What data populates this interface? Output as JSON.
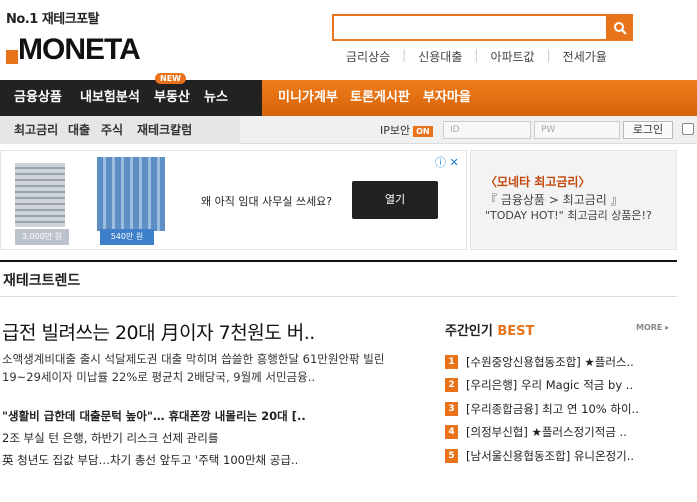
{
  "header": {
    "slogan": "No.1 재테크포탈",
    "logo": "MONETA",
    "search_placeholder": "",
    "hot_keywords": [
      "금리상승",
      "신용대출",
      "아파트값",
      "전세가율"
    ]
  },
  "nav": {
    "main": [
      "금융상품",
      "내보험분석",
      "부동산",
      "뉴스"
    ],
    "main_right": [
      "미니가계부",
      "토론게시판",
      "부자마을"
    ],
    "new_badge": "NEW",
    "sub": [
      "최고금리",
      "대출",
      "주식",
      "재테크칼럼"
    ]
  },
  "login": {
    "ip_security": "IP보안",
    "on": "ON",
    "id_placeholder": "ID",
    "pw_placeholder": "PW",
    "button": "로그인"
  },
  "ad": {
    "text": "왜 아직 임대 사무실 쓰세요?",
    "button": "열기",
    "label1": "3,000만 원",
    "label2": "540만 원",
    "icons": "ⓘ ✕"
  },
  "promo": {
    "line1": "〈모네타 최고금리〉",
    "line2": "『 금융상품 > 최고금리 』",
    "line3": "\"TODAY HOT!\" 최고금리 상품은!?"
  },
  "section": {
    "title": "재테크트렌드",
    "headline": "급전 빌려쓰는 20대 月이자 7천원도 버..",
    "summary": "소액생계비대출 출시 석달제도권 대출 막히며 씁쓸한 흥행한달 61만원안팎 빌린 19~29세이자 미납률 22%로 평균치 2배당국, 9월께 서민금융..",
    "news": [
      "\"생활비 급한데 대출문턱 높아\"… 휴대폰깡 내몰리는 20대 [..",
      "2조 부실 턴 은행, 하반기 리스크 선제 관리를",
      "英 청년도 집값 부담…차기 총선 앞두고 '주택 100만채 공급.."
    ]
  },
  "best": {
    "title_prefix": "주간인기 ",
    "title_accent": "BEST",
    "more": "MORE ▸",
    "items": [
      {
        "num": "1",
        "text": "[수원중앙신용협동조합] ★플러스.."
      },
      {
        "num": "2",
        "text": "[우리은행] 우리 Magic 적금 by .."
      },
      {
        "num": "3",
        "text": "[우리종합금융] 최고 연 10% 하이.."
      },
      {
        "num": "4",
        "text": "[의정부신협] ★플러스정기적금 .."
      },
      {
        "num": "5",
        "text": "[남서울신용협동조합] 유니온정기.."
      }
    ]
  }
}
